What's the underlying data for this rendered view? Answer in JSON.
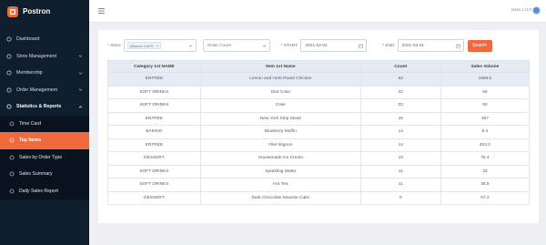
{
  "brand": {
    "name": "Postron"
  },
  "nav": {
    "items": [
      {
        "label": "Dashboard",
        "icon": "dashboard-icon"
      },
      {
        "label": "Store Management",
        "icon": "store-icon"
      },
      {
        "label": "Membership",
        "icon": "membership-icon"
      },
      {
        "label": "Order Management",
        "icon": "order-icon"
      },
      {
        "label": "Statistics & Reports",
        "icon": "chart-icon"
      }
    ],
    "sub_items": [
      {
        "label": "Time Card"
      },
      {
        "label": "Top Items"
      },
      {
        "label": "Sales by Order Type"
      },
      {
        "label": "Sales Summary"
      },
      {
        "label": "Daily Sales Report"
      }
    ]
  },
  "header": {
    "version": "Beta 1.0.0"
  },
  "filters": {
    "store_label": "Store",
    "store_tag": "Alliance CAFE",
    "order_placeholder": "Order Coure",
    "start_label": "START",
    "start_value": "2021-02-01",
    "end_label": "END",
    "end_value": "2021-03-01",
    "search_label": "Search"
  },
  "table": {
    "headers": [
      "Category 1st NAME",
      "Item 1st Name",
      "Count",
      "Sales Volume"
    ],
    "rows": [
      [
        "ENTRÉE",
        "Lemon and Herb Roast Chicken",
        "82",
        "1869.5"
      ],
      [
        "SOFT DRINKS",
        "Diet Coke",
        "22",
        "55"
      ],
      [
        "SOFT DRINKS",
        "Coke",
        "22",
        "55"
      ],
      [
        "ENTRÉE",
        "New York Strip Steak",
        "15",
        "387"
      ],
      [
        "BAKING",
        "Blueberry Muffin",
        "14",
        "8.4"
      ],
      [
        "ENTRÉE",
        "Filet Mignon",
        "14",
        "403.2"
      ],
      [
        "DESSERT",
        "Housemade Ice Cream",
        "13",
        "75.4"
      ],
      [
        "SOFT DRINKS",
        "Sparkling Water",
        "11",
        "33"
      ],
      [
        "SOFT DRINKS",
        "Hot Tea",
        "11",
        "38.5"
      ],
      [
        "DESSERT",
        "Dark Chocolate Mousse Cake",
        "9",
        "67.2"
      ]
    ]
  },
  "colors": {
    "accent": "#f06a3e",
    "sidebar": "#0e1e2d"
  }
}
